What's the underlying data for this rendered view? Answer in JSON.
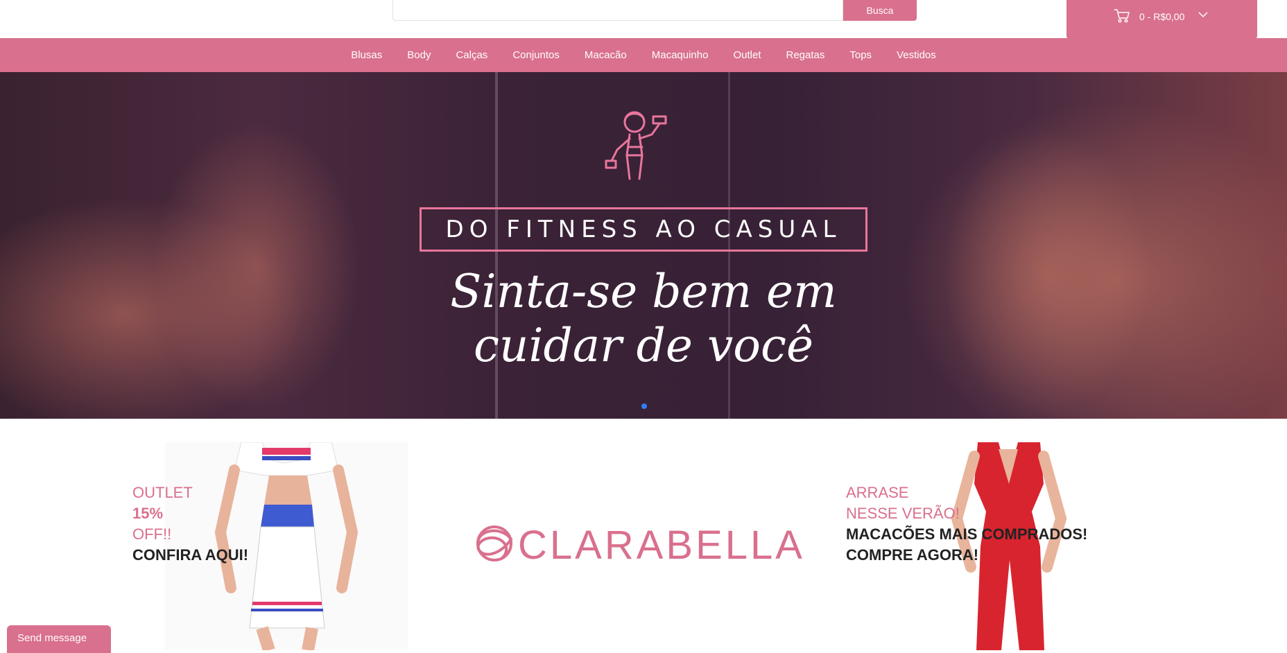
{
  "search": {
    "placeholder": "",
    "value": "",
    "button_label": "Busca"
  },
  "cart": {
    "label": "0 - R$0,00",
    "icon": "cart-icon"
  },
  "nav": {
    "items": [
      {
        "label": "Blusas"
      },
      {
        "label": "Body"
      },
      {
        "label": "Calças"
      },
      {
        "label": "Conjuntos"
      },
      {
        "label": "Macacão"
      },
      {
        "label": "Macaquinho"
      },
      {
        "label": "Outlet"
      },
      {
        "label": "Regatas"
      },
      {
        "label": "Tops"
      },
      {
        "label": "Vestidos"
      }
    ]
  },
  "hero": {
    "boxed_title": "DO FITNESS AO CASUAL",
    "script_line1": "Sinta-se bem em",
    "script_line2": "cuidar de você",
    "icon": "fitness-woman-icon",
    "slides_total": 1,
    "active_slide": 1
  },
  "promo": {
    "left": {
      "line1": "OUTLET",
      "line2": "15%",
      "line3": "OFF!!",
      "line4": "CONFIRA AQUI!"
    },
    "brand": "CLARABELLA",
    "right": {
      "line1": "ARRASE",
      "line2": "NESSE VERÃO!",
      "line3": "MACACÕES MAIS COMPRADOS!",
      "line4": "COMPRE AGORA!"
    }
  },
  "chat": {
    "label": "Send message"
  },
  "colors": {
    "accent": "#d9708d",
    "hero_border": "#e8769c",
    "slider_dot": "#2f7ff0"
  }
}
